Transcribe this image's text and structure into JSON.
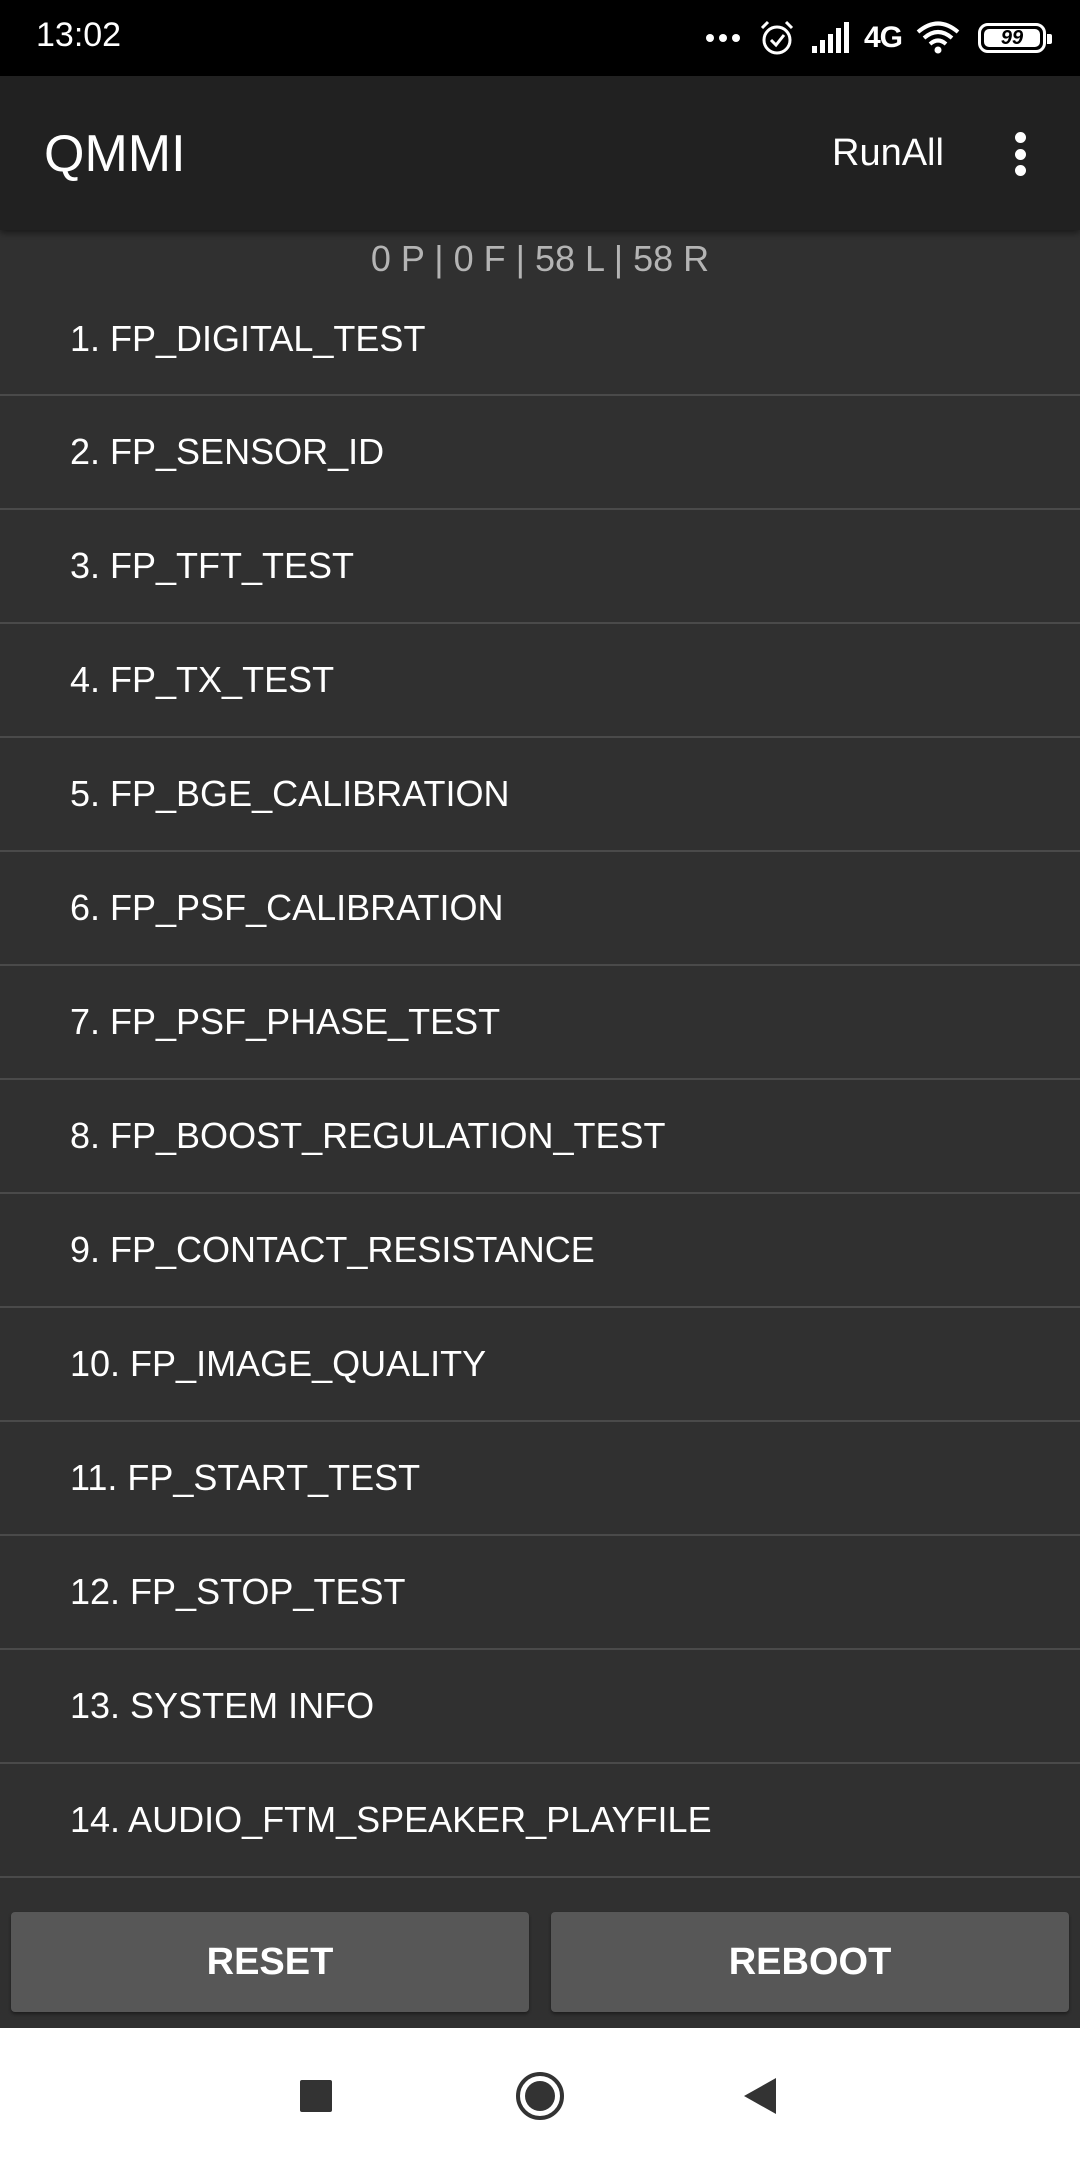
{
  "status_bar": {
    "time": "13:02",
    "network": "4G",
    "battery": "99"
  },
  "app_bar": {
    "title": "QMMI",
    "run_all_label": "RunAll"
  },
  "summary": "0 P | 0 F  | 58 L | 58 R",
  "tests": [
    "1. FP_DIGITAL_TEST",
    "2. FP_SENSOR_ID",
    "3. FP_TFT_TEST",
    "4. FP_TX_TEST",
    "5. FP_BGE_CALIBRATION",
    "6. FP_PSF_CALIBRATION",
    "7. FP_PSF_PHASE_TEST",
    "8. FP_BOOST_REGULATION_TEST",
    "9. FP_CONTACT_RESISTANCE",
    "10. FP_IMAGE_QUALITY",
    "11. FP_START_TEST",
    "12. FP_STOP_TEST",
    "13. SYSTEM INFO",
    "14. AUDIO_FTM_SPEAKER_PLAYFILE"
  ],
  "buttons": {
    "reset": "RESET",
    "reboot": "REBOOT"
  },
  "icons": {
    "status": [
      "more-dots-icon",
      "alarm-icon",
      "signal-icon",
      "wifi-icon",
      "battery-icon"
    ],
    "nav": [
      "recent-apps-icon",
      "home-icon",
      "back-icon"
    ]
  }
}
